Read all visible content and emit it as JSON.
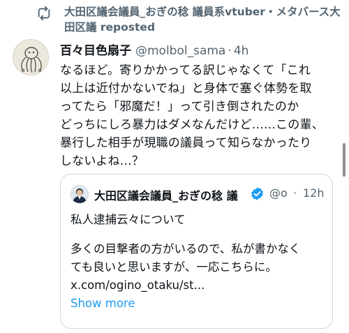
{
  "repost": {
    "icon": "repost-icon",
    "text": "大田区議会議員_おぎの稔 議員系vtuber・メタバース大田区議 reposted"
  },
  "tweet": {
    "avatar_icon": "avatar-illustration",
    "author_name": "百々目色扇子",
    "handle": "@molbol_sama",
    "separator": "·",
    "time": "4h",
    "lines": [
      "なるほど。寄りかかってる訳じゃなくて「これ",
      "以上は近付かないでね」と身体で塞ぐ体勢を取",
      "ってたら「邪魔だ！」って引き倒されたのか",
      "どっちにしろ暴力はダメなんだけど……この輩、",
      "暴行した相手が現職の議員って知らなかったり",
      "しないよね…？"
    ]
  },
  "quote": {
    "author_name": "大田区議会議員_おぎの稔 議",
    "handle": "@o",
    "separator": "·",
    "time": "12h",
    "title": "私人逮捕云々について",
    "lines": [
      "多くの目撃者の方がいるので、私が書かなく",
      "ても良いと思いますが、一応こちらに。"
    ],
    "link": "x.com/ogino_otaku/st...",
    "show_more": "Show more"
  },
  "colors": {
    "accent": "#1d9bf0",
    "secondary_text": "#536471",
    "border": "#cfd9de"
  }
}
